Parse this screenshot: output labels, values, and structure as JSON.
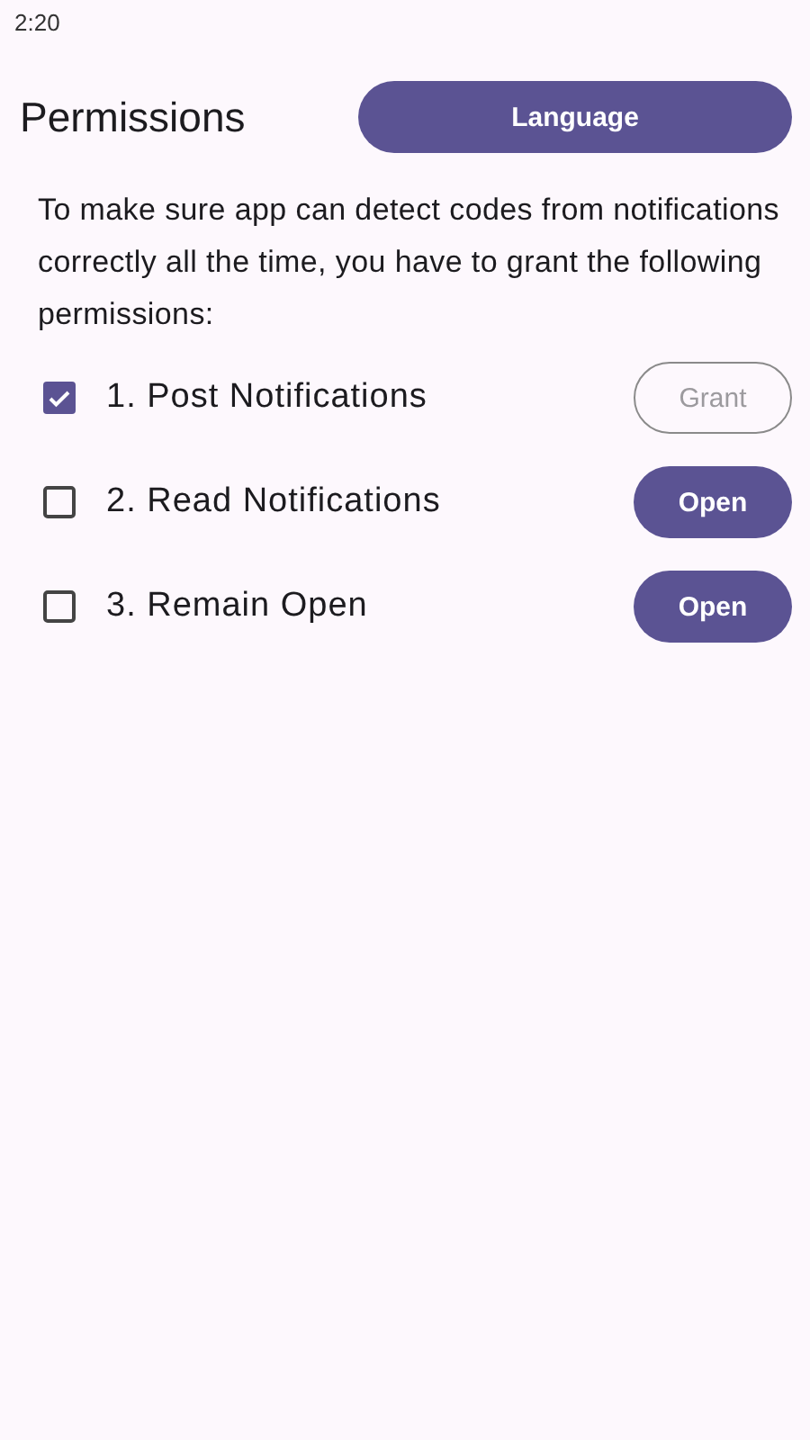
{
  "status_bar": {
    "time": "2:20"
  },
  "header": {
    "title": "Permissions",
    "language_button": "Language"
  },
  "description": "To make sure app can detect codes from notifications correctly all the time, you have to grant the following permissions:",
  "permissions": [
    {
      "label": "1. Post Notifications",
      "checked": true,
      "button": "Grant",
      "button_disabled": true
    },
    {
      "label": "2. Read Notifications",
      "checked": false,
      "button": "Open",
      "button_disabled": false
    },
    {
      "label": "3. Remain Open",
      "checked": false,
      "button": "Open",
      "button_disabled": false
    }
  ]
}
